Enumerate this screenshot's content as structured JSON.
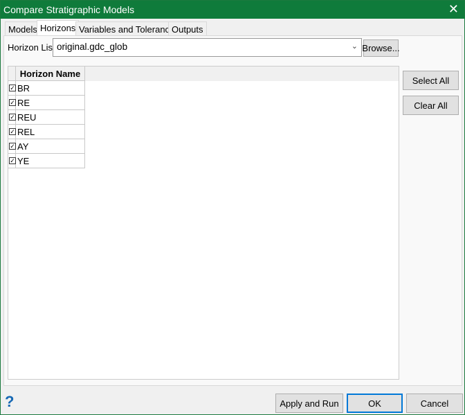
{
  "window": {
    "title": "Compare Stratigraphic Models",
    "close_icon": "close-icon"
  },
  "tabs": [
    {
      "label": "Models"
    },
    {
      "label": "Horizons",
      "active": true
    },
    {
      "label": "Variables and Tolerances"
    },
    {
      "label": "Outputs"
    }
  ],
  "horizon_list": {
    "label": "Horizon List",
    "value": "original.gdc_glob",
    "browse_label": "Browse..."
  },
  "grid": {
    "header": "Horizon Name",
    "rows": [
      {
        "name": "BR",
        "checked": true
      },
      {
        "name": "RE",
        "checked": true
      },
      {
        "name": "REU",
        "checked": true
      },
      {
        "name": "REL",
        "checked": true
      },
      {
        "name": "AY",
        "checked": true
      },
      {
        "name": "YE",
        "checked": true
      }
    ]
  },
  "side_buttons": {
    "select_all": "Select All",
    "clear_all": "Clear All"
  },
  "footer": {
    "help": "?",
    "apply_run": "Apply and Run",
    "ok": "OK",
    "cancel": "Cancel"
  },
  "colors": {
    "titlebar": "#0f7b3b",
    "help": "#1668b4",
    "ok_border": "#0078d7"
  }
}
